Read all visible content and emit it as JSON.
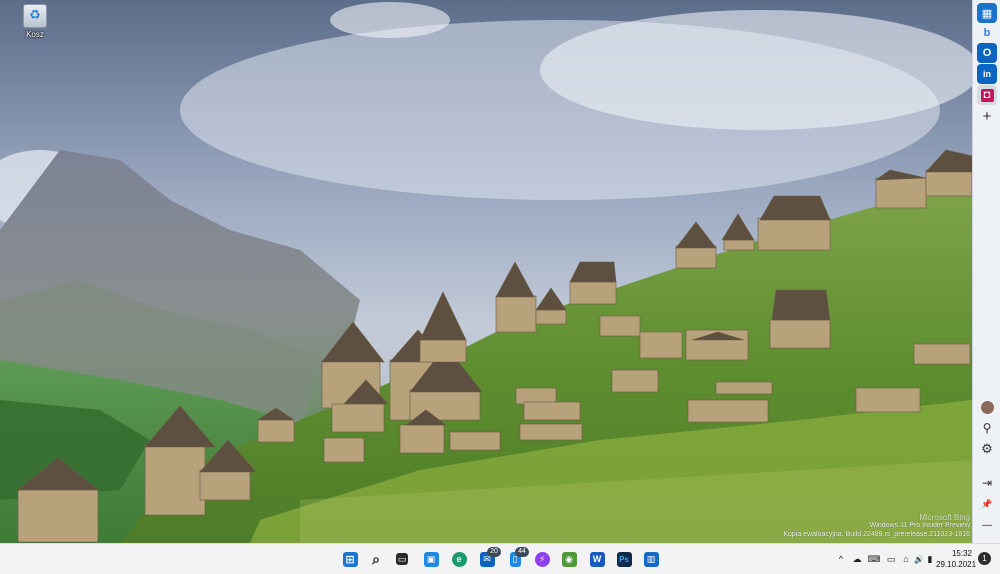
{
  "desktop": {
    "icons": [
      {
        "label": "Kosz",
        "icon": "recycle-bin-icon"
      }
    ]
  },
  "sidebar": {
    "top_items": [
      {
        "icon": "outlook-calendar-icon",
        "glyph": "▦",
        "color": "#1a73c9"
      },
      {
        "icon": "bing-icon",
        "glyph": "b",
        "color": "#2f7fe0"
      },
      {
        "icon": "outlook-icon",
        "glyph": "O",
        "color": "#0a64c0"
      },
      {
        "icon": "linkedin-icon",
        "glyph": "in",
        "color": "#0a66c2"
      },
      {
        "icon": "app-icon",
        "glyph": "◘",
        "color": "#c2185b"
      },
      {
        "icon": "add-icon",
        "glyph": "+",
        "color": "#333333"
      }
    ],
    "bottom_items": [
      {
        "icon": "avatar-icon",
        "glyph": "●",
        "color": "#8a6a5a"
      },
      {
        "icon": "extensions-icon",
        "glyph": "⚲",
        "color": "#333333"
      },
      {
        "icon": "settings-icon",
        "glyph": "⚙",
        "color": "#333333"
      },
      {
        "icon": "collapse-icon",
        "glyph": "⇥",
        "color": "#333333"
      },
      {
        "icon": "pin-icon",
        "glyph": "📌",
        "color": "#333333"
      },
      {
        "icon": "minimize-icon",
        "glyph": "—",
        "color": "#333333"
      }
    ]
  },
  "watermark": {
    "line1": "Windows 11 Pro Insider Preview",
    "line2": "Kopia ewaluacyjna. Build 22489.rs_prerelease.211023-1816",
    "logo_text": "Microsoft Bing"
  },
  "taskbar": {
    "apps": [
      {
        "icon": "start-icon",
        "glyph": "⊞",
        "bg": "#1976d2",
        "badge": ""
      },
      {
        "icon": "search-icon",
        "glyph": "⌕",
        "bg": "transparent",
        "badge": ""
      },
      {
        "icon": "task-view-icon",
        "glyph": "▭",
        "bg": "#2b2b2b",
        "badge": ""
      },
      {
        "icon": "widgets-icon",
        "glyph": "▣",
        "bg": "#1e88e5",
        "badge": ""
      },
      {
        "icon": "edge-icon",
        "glyph": "e",
        "bg": "#1a9b6e",
        "badge": ""
      },
      {
        "icon": "mail-icon",
        "glyph": "✉",
        "bg": "#0a64c0",
        "badge": "20"
      },
      {
        "icon": "phone-icon",
        "glyph": "▯",
        "bg": "#1e88e5",
        "badge": "44"
      },
      {
        "icon": "messenger-icon",
        "glyph": "⚡",
        "bg": "#8e3ff0",
        "badge": ""
      },
      {
        "icon": "greenshot-icon",
        "glyph": "◉",
        "bg": "#4e9a3a",
        "badge": ""
      },
      {
        "icon": "word-icon",
        "glyph": "W",
        "bg": "#185abd",
        "badge": ""
      },
      {
        "icon": "photoshop-icon",
        "glyph": "Ps",
        "bg": "#0f2a4a",
        "badge": ""
      },
      {
        "icon": "trello-icon",
        "glyph": "▥",
        "bg": "#1768c4",
        "badge": ""
      }
    ],
    "tray": [
      {
        "icon": "chevron-up-icon",
        "glyph": "^"
      },
      {
        "icon": "cloud-icon",
        "glyph": "☁"
      },
      {
        "icon": "keyboard-icon",
        "glyph": "⌨"
      },
      {
        "icon": "monitor-icon",
        "glyph": "▭"
      },
      {
        "icon": "network-icon",
        "glyph": "⌂"
      },
      {
        "icon": "volume-icon",
        "glyph": "🔊"
      },
      {
        "icon": "battery-icon",
        "glyph": "▮"
      }
    ],
    "time": "15:32",
    "date": "29.10.2021",
    "notifications": "1"
  }
}
